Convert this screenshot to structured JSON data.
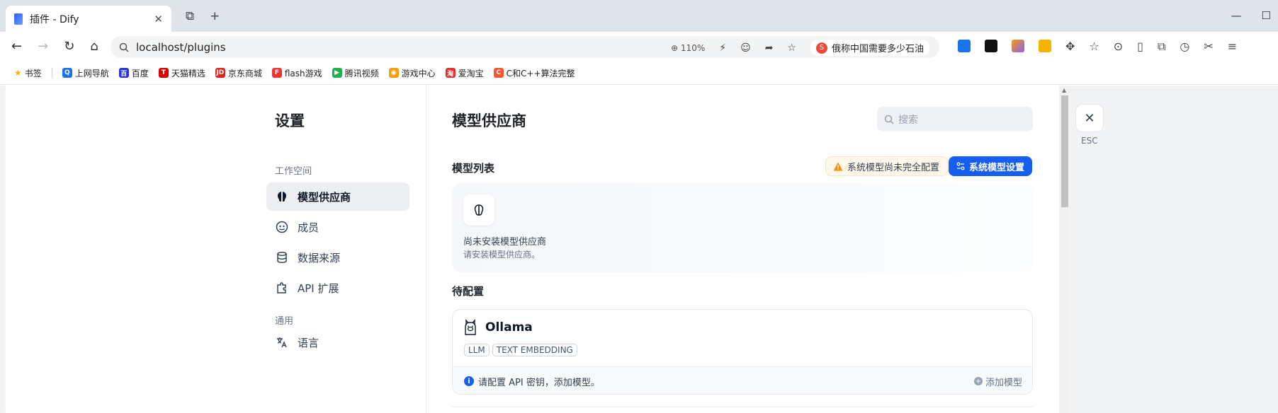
{
  "browser": {
    "tab_title": "插件 - Dify",
    "tab_close": "✕",
    "url": "localhost/plugins",
    "zoom": "110%",
    "search_text": "俄称中国需要多少石油",
    "bookmarks": [
      "书签",
      "上网导航",
      "百度",
      "天猫精选",
      "京东商城",
      "flash游戏",
      "腾讯视频",
      "游戏中心",
      "爱淘宝",
      "C和C++算法完整"
    ]
  },
  "sidebar": {
    "title": "设置",
    "group_workspace": "工作空间",
    "group_general": "通用",
    "items": [
      {
        "label": "模型供应商"
      },
      {
        "label": "成员"
      },
      {
        "label": "数据来源"
      },
      {
        "label": "API 扩展"
      },
      {
        "label": "语言"
      }
    ]
  },
  "main": {
    "title": "模型供应商",
    "search_placeholder": "搜索",
    "model_list_title": "模型列表",
    "warning": "系统模型尚未完全配置",
    "system_model_button": "系统模型设置",
    "empty_title": "尚未安装模型供应商",
    "empty_desc": "请安装模型供应商。",
    "pending_title": "待配置",
    "provider": {
      "name": "Ollama",
      "tags": [
        "LLM",
        "TEXT EMBEDDING"
      ],
      "hint": "请配置 API 密钥，添加模型。",
      "add_model": "添加模型"
    }
  },
  "close": {
    "label": "ESC"
  },
  "colors": {
    "accent": "#155eef",
    "warning_bg": "#fff7ea",
    "active_bg": "#eceef1"
  }
}
